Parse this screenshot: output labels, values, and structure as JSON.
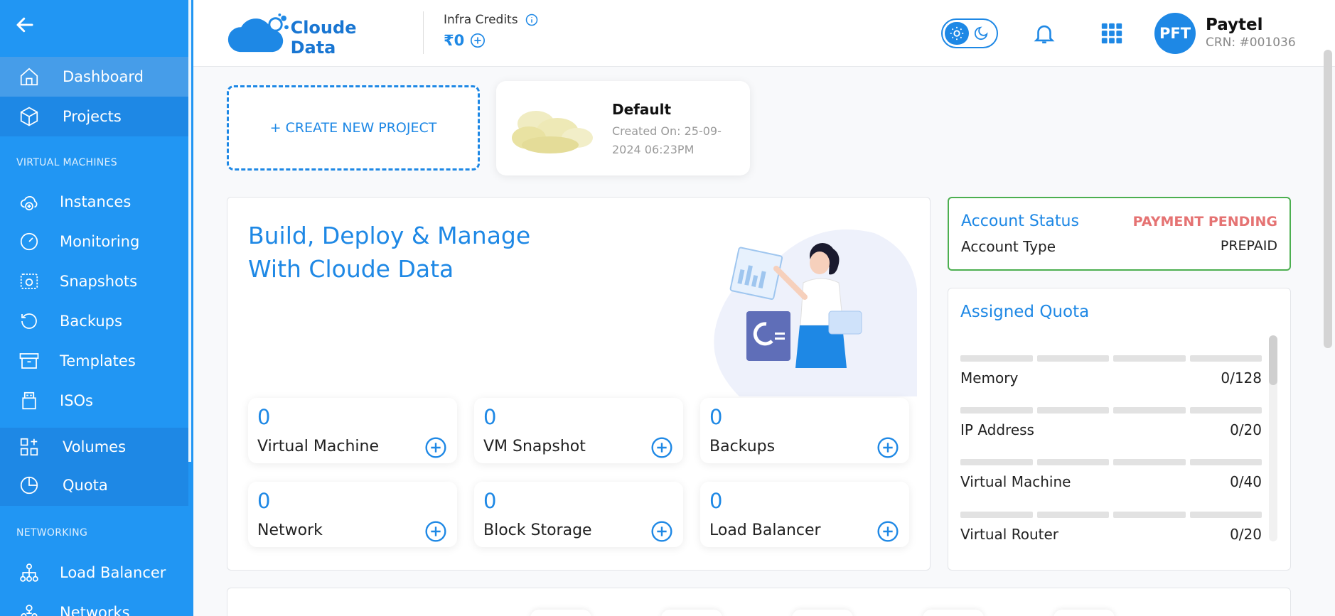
{
  "sidebar": {
    "top_items": [
      {
        "label": "Dashboard",
        "icon": "home-icon",
        "active": true
      },
      {
        "label": "Projects",
        "icon": "cube-icon"
      }
    ],
    "sections": [
      {
        "label": "VIRTUAL MACHINES"
      },
      {
        "label": "NETWORKING"
      }
    ],
    "vm_items": [
      {
        "label": "Instances",
        "icon": "cloud-plus-icon"
      },
      {
        "label": "Monitoring",
        "icon": "gauge-icon"
      },
      {
        "label": "Snapshots",
        "icon": "camera-icon"
      },
      {
        "label": "Backups",
        "icon": "history-icon"
      },
      {
        "label": "Templates",
        "icon": "archive-icon"
      },
      {
        "label": "ISOs",
        "icon": "disc-icon"
      }
    ],
    "storage_items": [
      {
        "label": "Volumes",
        "icon": "volumes-icon"
      },
      {
        "label": "Quota",
        "icon": "pie-chart-icon"
      }
    ],
    "network_items": [
      {
        "label": "Load Balancer",
        "icon": "hierarchy-icon"
      },
      {
        "label": "Networks",
        "icon": "users-network-icon"
      }
    ]
  },
  "header": {
    "brand": "Cloude Data",
    "credits_label": "Infra Credits",
    "credits_value": "₹0",
    "user_initials": "PFT",
    "user_name": "Paytel",
    "user_crn": "CRN: #001036"
  },
  "projects": {
    "create_label": "+ CREATE NEW PROJECT",
    "items": [
      {
        "name": "Default",
        "created": "Created On: 25-09-2024 06:23PM"
      }
    ]
  },
  "hero": {
    "line1": "Build, Deploy & Manage",
    "line2": "With Cloude Data"
  },
  "stats": [
    {
      "value": "0",
      "label": "Virtual Machine"
    },
    {
      "value": "0",
      "label": "VM Snapshot"
    },
    {
      "value": "0",
      "label": "Backups"
    },
    {
      "value": "0",
      "label": "Network"
    },
    {
      "value": "0",
      "label": "Block Storage"
    },
    {
      "value": "0",
      "label": "Load Balancer"
    }
  ],
  "account": {
    "status_label": "Account Status",
    "status_value": "PAYMENT PENDING",
    "type_label": "Account Type",
    "type_value": "PREPAID"
  },
  "quota": {
    "title": "Assigned Quota",
    "items": [
      {
        "name": "Memory",
        "value": "0/128"
      },
      {
        "name": "IP Address",
        "value": "0/20"
      },
      {
        "name": "Virtual Machine",
        "value": "0/40"
      },
      {
        "name": "Virtual Router",
        "value": "0/20"
      }
    ]
  },
  "colors": {
    "primary": "#2196f3",
    "accent": "#1e88e5",
    "success": "#4caf50",
    "danger": "#e57373"
  }
}
